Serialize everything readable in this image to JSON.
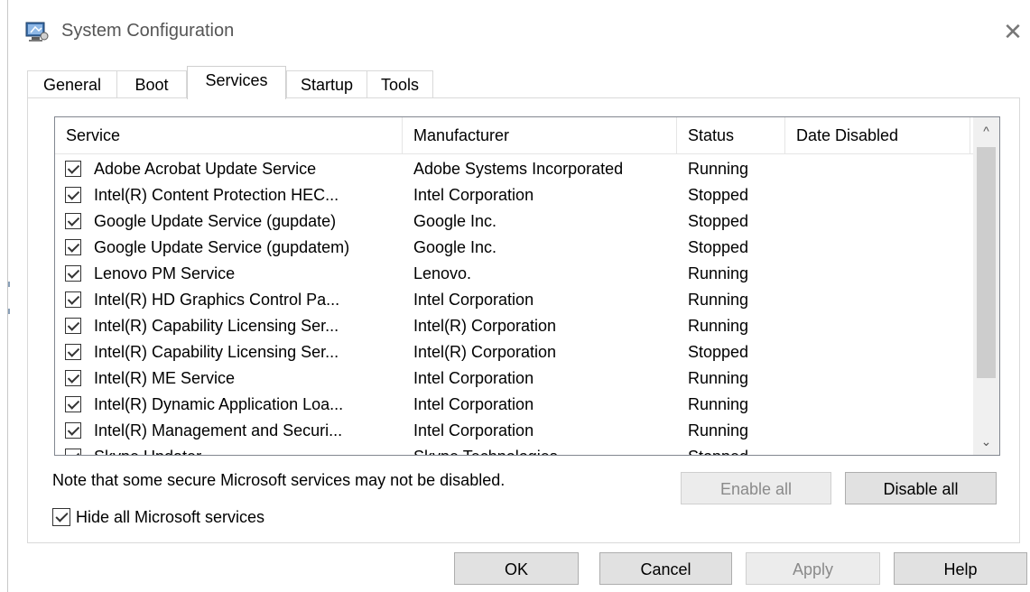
{
  "window": {
    "title": "System Configuration",
    "close_glyph": "✕"
  },
  "tabs": [
    {
      "label": "General",
      "active": false
    },
    {
      "label": "Boot",
      "active": false
    },
    {
      "label": "Services",
      "active": true
    },
    {
      "label": "Startup",
      "active": false
    },
    {
      "label": "Tools",
      "active": false
    }
  ],
  "services": {
    "columns": {
      "service": "Service",
      "manufacturer": "Manufacturer",
      "status": "Status",
      "date_disabled": "Date Disabled"
    },
    "rows": [
      {
        "checked": true,
        "service": "Adobe Acrobat Update Service",
        "manufacturer": "Adobe Systems Incorporated",
        "status": "Running",
        "date_disabled": ""
      },
      {
        "checked": true,
        "service": "Intel(R) Content Protection HEC...",
        "manufacturer": "Intel Corporation",
        "status": "Stopped",
        "date_disabled": ""
      },
      {
        "checked": true,
        "service": "Google Update Service (gupdate)",
        "manufacturer": "Google Inc.",
        "status": "Stopped",
        "date_disabled": ""
      },
      {
        "checked": true,
        "service": "Google Update Service (gupdatem)",
        "manufacturer": "Google Inc.",
        "status": "Stopped",
        "date_disabled": ""
      },
      {
        "checked": true,
        "service": "Lenovo PM Service",
        "manufacturer": "Lenovo.",
        "status": "Running",
        "date_disabled": ""
      },
      {
        "checked": true,
        "service": "Intel(R) HD Graphics Control Pa...",
        "manufacturer": "Intel Corporation",
        "status": "Running",
        "date_disabled": ""
      },
      {
        "checked": true,
        "service": "Intel(R) Capability Licensing Ser...",
        "manufacturer": "Intel(R) Corporation",
        "status": "Running",
        "date_disabled": ""
      },
      {
        "checked": true,
        "service": "Intel(R) Capability Licensing Ser...",
        "manufacturer": "Intel(R) Corporation",
        "status": "Stopped",
        "date_disabled": ""
      },
      {
        "checked": true,
        "service": "Intel(R) ME Service",
        "manufacturer": "Intel Corporation",
        "status": "Running",
        "date_disabled": ""
      },
      {
        "checked": true,
        "service": "Intel(R) Dynamic Application Loa...",
        "manufacturer": "Intel Corporation",
        "status": "Running",
        "date_disabled": ""
      },
      {
        "checked": true,
        "service": "Intel(R) Management and Securi...",
        "manufacturer": "Intel Corporation",
        "status": "Running",
        "date_disabled": ""
      },
      {
        "checked": true,
        "service": "Skype Updater",
        "manufacturer": "Skype Technologies",
        "status": "Stopped",
        "date_disabled": ""
      }
    ],
    "scroll_up_glyph": "^",
    "scroll_down_glyph": "⌄"
  },
  "note": "Note that some secure Microsoft services may not be disabled.",
  "enable_all_label": "Enable all",
  "disable_all_label": "Disable all",
  "hide_ms_label": "Hide all Microsoft services",
  "hide_ms_checked": true,
  "footer": {
    "ok_label": "OK",
    "cancel_label": "Cancel",
    "apply_label": "Apply",
    "help_label": "Help"
  },
  "colors": {
    "accent_border": "#828790",
    "disabled_text": "#8a8a8a",
    "button_bg": "#e1e1e1"
  },
  "icons": {
    "app": "msconfig-icon",
    "close": "close-icon",
    "checkbox": "checkmark-icon"
  }
}
